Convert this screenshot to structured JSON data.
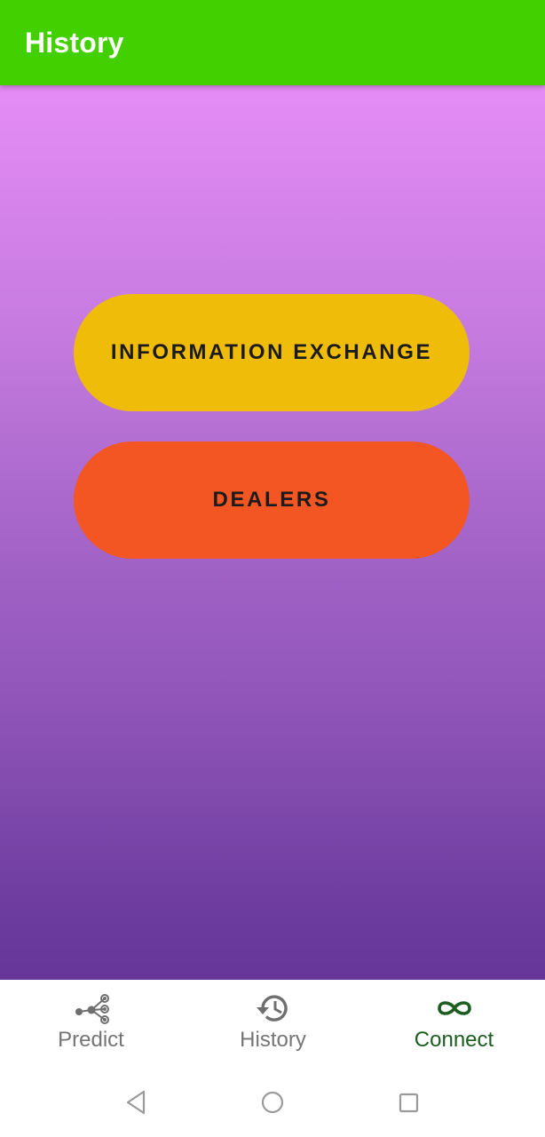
{
  "appbar": {
    "title": "History",
    "background": "#43d000"
  },
  "content": {
    "gradient_top": "#e58cf6",
    "gradient_bottom": "#663699",
    "buttons": [
      {
        "label": "INFORMATION EXCHANGE",
        "color": "#f0bc0a"
      },
      {
        "label": "DEALERS",
        "color": "#f35523"
      }
    ]
  },
  "bottom_nav": {
    "items": [
      {
        "label": "Predict",
        "icon": "share-nodes-icon",
        "selected": false
      },
      {
        "label": "History",
        "icon": "history-icon",
        "selected": false
      },
      {
        "label": "Connect",
        "icon": "infinity-icon",
        "selected": true
      }
    ],
    "inactive_color": "#757575",
    "active_color": "#1b5e20"
  },
  "system_nav": {
    "items": [
      {
        "icon": "back-triangle-icon"
      },
      {
        "icon": "home-circle-icon"
      },
      {
        "icon": "recents-square-icon"
      }
    ]
  }
}
